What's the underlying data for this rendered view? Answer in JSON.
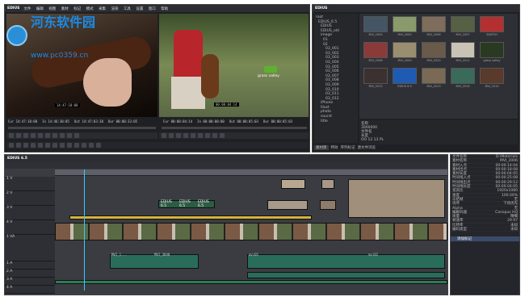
{
  "app": {
    "title": "EDIUS",
    "menu": [
      "文件",
      "编辑",
      "视图",
      "素材",
      "标记",
      "模式",
      "采集",
      "渲染",
      "工具",
      "设置",
      "窗口",
      "帮助"
    ]
  },
  "watermark": {
    "title": "河东软件园",
    "url": "www.pc0359.cn"
  },
  "player": {
    "timecodes_left": [
      "Cur 14:47:18:08",
      "In 14:46:30:05",
      "Out 14:47:03:10",
      "Dur 00:00:33:05"
    ],
    "timecodes_right": [
      "Cur 00:00:04:14",
      "In 00:00:00:00",
      "Out 00:00:05:03",
      "Dur 00:00:05:03"
    ],
    "overlay_left": "14:47:18:08",
    "overlay_right": "00:00:04:14",
    "logo_text": "grass valley"
  },
  "bin": {
    "title": "EDIUS",
    "tree": [
      "root",
      "EDIUS_6.5",
      "EDIUS",
      "EDIUS_old",
      "image",
      "01",
      "02",
      "03_001",
      "03_002",
      "03_003",
      "03_004",
      "03_005",
      "03_006",
      "03_007",
      "03_008",
      "03_009",
      "03_010",
      "03_011",
      "03_012",
      "iPhone",
      "Illust",
      "photo",
      "sound",
      "title"
    ],
    "thumbs": [
      "MVI_2004",
      "MVI_2005",
      "MVI_2006",
      "MVI_2007",
      "SWITCH",
      "MVI_2008",
      "MVI_2009",
      "MVI_2010",
      "MVI_2011",
      "grass valley",
      "MVI_2012",
      "EDIUS 6.5",
      "MVI_2013",
      "MVI_2014",
      "MVI_2015"
    ],
    "info": [
      "名称",
      "3000000",
      "文件名",
      "",
      "长度",
      "",
      "OO 12 13 PL",
      "ST 0.0 16"
    ],
    "tabs": [
      "素材库",
      "特效",
      "序列标记",
      "源文件浏览"
    ]
  },
  "timeline": {
    "title": "EDIUS 6.5",
    "tracks": [
      "1 V",
      "2 V",
      "3 V",
      "4 V",
      "1 VA",
      "1 A",
      "2 A",
      "3 A",
      "4 A",
      "T"
    ],
    "clip_labels": [
      "MVI_2004",
      "MVI_2005",
      "MVI_2006"
    ],
    "audio_labels": [
      "MVI_1...",
      "MVI_1...",
      "MVI_3040",
      "MVI_3040",
      "mvi01",
      "mvi02"
    ],
    "title_clip": "EDIUS 6.5"
  },
  "props": {
    "rows": [
      [
        "文件名称",
        "D:\\Materials"
      ],
      [
        "素材名称",
        "MVI_2006"
      ],
      [
        "素材入点",
        "00:00:14:04"
      ],
      [
        "素材出点",
        "00:00:18:08"
      ],
      [
        "素材长度",
        "00:00:04:05"
      ],
      [
        "时间线入点",
        "00:00:25:08"
      ],
      [
        "时间线出点",
        "00:00:29:12"
      ],
      [
        "时间线长度",
        "00:00:04:05"
      ],
      [
        "宽高比",
        "1920x1080"
      ],
      [
        "速度",
        "100.00%"
      ],
      [
        "冻结帧",
        "无"
      ],
      [
        "场序",
        "下场优先"
      ],
      [
        "Alpha",
        "无"
      ],
      [
        "编解码器",
        "Canopus HQ"
      ],
      [
        "质量",
        "精细"
      ],
      [
        "帧速率",
        "29.97"
      ],
      [
        "比特率",
        "未知"
      ],
      [
        "编码类型",
        "未知"
      ]
    ],
    "list_item": "添加标记"
  }
}
